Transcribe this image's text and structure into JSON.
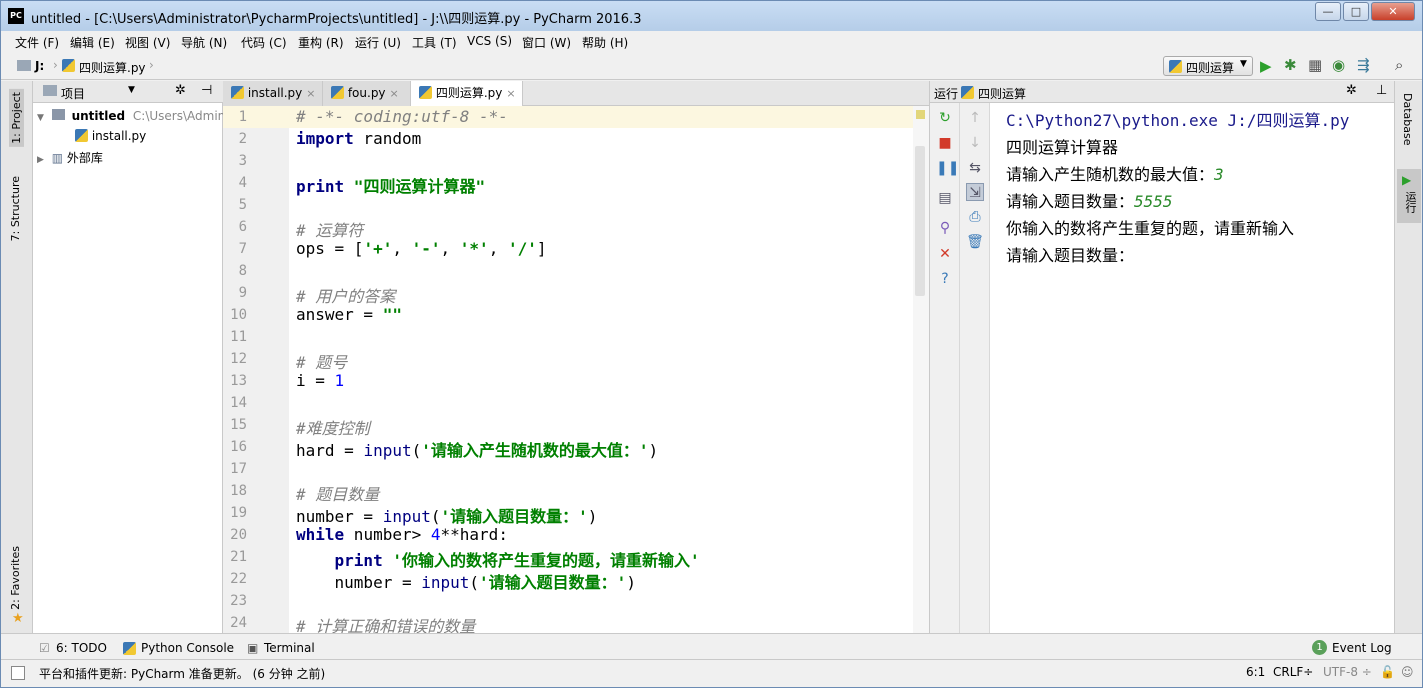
{
  "window": {
    "title": "untitled - [C:\\Users\\Administrator\\PycharmProjects\\untitled] - J:\\\\四则运算.py - PyCharm 2016.3",
    "app_icon": "PC",
    "min": "—",
    "max": "□",
    "close": "✕"
  },
  "menu": [
    "文件 (F)",
    "编辑 (E)",
    "视图 (V)",
    "导航 (N)",
    "代码 (C)",
    "重构 (R)",
    "运行 (U)",
    "工具 (T)",
    "VCS (S)",
    "窗口 (W)",
    "帮助 (H)"
  ],
  "nav": {
    "crumb_root": "J:",
    "crumb_file": "四则运算.py",
    "run_config": "四则运算"
  },
  "left_tabs": {
    "project": "1: Project",
    "structure": "7: Structure",
    "favorites": "2: Favorites"
  },
  "project": {
    "header": "项目",
    "root_name": "untitled",
    "root_path": "C:\\Users\\Admini",
    "child": "install.py",
    "external": "外部库"
  },
  "tabs": [
    {
      "label": "install.py",
      "close": "×"
    },
    {
      "label": "fou.py",
      "close": "×"
    },
    {
      "label": "四则运算.py",
      "close": "×"
    }
  ],
  "line_numbers": [
    "1",
    "2",
    "3",
    "4",
    "5",
    "6",
    "7",
    "8",
    "9",
    "10",
    "11",
    "12",
    "13",
    "14",
    "15",
    "16",
    "17",
    "18",
    "19",
    "20",
    "21",
    "22",
    "23",
    "24"
  ],
  "code": {
    "l1": "# -*- coding:utf-8 -*-",
    "l2_kw": "import",
    "l2_rest": " random",
    "l4_kw": "print",
    "l4_str": " \"四则运算计算器\"",
    "l6": "# 运算符",
    "l7_a": "ops = [",
    "l7_s1": "'+'",
    "l7_c1": ", ",
    "l7_s2": "'-'",
    "l7_c2": ", ",
    "l7_s3": "'*'",
    "l7_c3": ", ",
    "l7_s4": "'/'",
    "l7_e": "]",
    "l9": "# 用户的答案",
    "l10_a": "answer = ",
    "l10_s": "\"\"",
    "l12": "# 题号",
    "l13_a": "i = ",
    "l13_n": "1",
    "l15": "#难度控制",
    "l16_a": "hard = ",
    "l16_f": "input",
    "l16_p": "(",
    "l16_s": "'请输入产生随机数的最大值：'",
    "l16_e": ")",
    "l18": "# 题目数量",
    "l19_a": "number = ",
    "l19_f": "input",
    "l19_p": "(",
    "l19_s": "'请输入题目数量：'",
    "l19_e": ")",
    "l20_kw": "while",
    "l20_a": " number> ",
    "l20_n": "4",
    "l20_e": "**hard:",
    "l21_kw": "    print",
    "l21_s": " '你输入的数将产生重复的题，请重新输入'",
    "l22_a": "    number = ",
    "l22_f": "input",
    "l22_p": "(",
    "l22_s": "'请输入题目数量：'",
    "l22_e": ")",
    "l24": "# 计算正确和错误的数量"
  },
  "run": {
    "header_label": "运行",
    "header_config": "四则运算",
    "out1": "C:\\Python27\\python.exe J:/四则运算.py",
    "out2": "四则运算计算器",
    "out3_a": "请输入产生随机数的最大值：",
    "out3_b": "3",
    "out4_a": "请输入题目数量：",
    "out4_b": "5555",
    "out5": "你输入的数将产生重复的题，请重新输入",
    "out6": "请输入题目数量："
  },
  "right_tabs": {
    "database": "Database",
    "run": "运行"
  },
  "bottom": {
    "todo": "6: TODO",
    "console": "Python Console",
    "terminal": "Terminal",
    "event_count": "1",
    "event_log": "Event Log"
  },
  "status": {
    "message": "平台和插件更新: PyCharm 准备更新。 (6 分钟 之前)",
    "position": "6:1",
    "line_sep": "CRLF÷",
    "encoding": "UTF-8 ÷"
  }
}
